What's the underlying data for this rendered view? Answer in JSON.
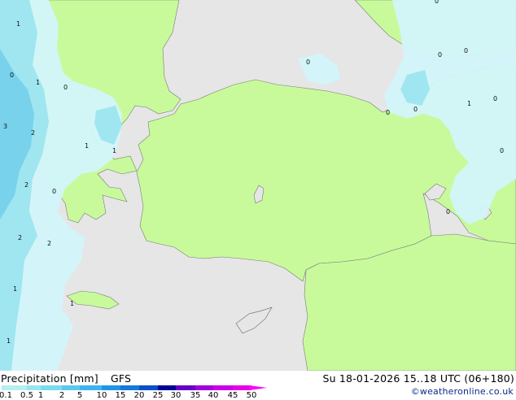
{
  "footer": {
    "product": "Precipitation [mm]",
    "model": "GFS",
    "valid_time": "Su 18-01-2026 15..18 UTC (06+180)",
    "credit": "©weatheronline.co.uk"
  },
  "colorbar": {
    "ticks": [
      "0.1",
      "0.5",
      "1",
      "2",
      "5",
      "10",
      "15",
      "20",
      "25",
      "30",
      "35",
      "40",
      "45",
      "50"
    ],
    "colors": [
      "#b4f0f0",
      "#96e6f0",
      "#78dcf0",
      "#5ac8f0",
      "#3cb4f0",
      "#1e96e6",
      "#1478dc",
      "#0a50c8",
      "#000096",
      "#6400c8",
      "#a000dc",
      "#c800e6",
      "#e600e6",
      "#ff00ff"
    ]
  },
  "map": {
    "colors": {
      "sea": "#e6e6e6",
      "land": "#c8fa9b",
      "precip_light": "#d2f5fa",
      "precip_medium": "#a0e6f0",
      "precip_heavy": "#78d2eb",
      "coast": "#7a7a7a"
    },
    "labels": [
      "1",
      "0",
      "1",
      "0",
      "3",
      "2",
      "1",
      "1",
      "2",
      "0",
      "2",
      "2",
      "1",
      "1",
      "1",
      "0",
      "0",
      "0",
      "0",
      "1",
      "0",
      "0",
      "0",
      "0",
      "0"
    ]
  }
}
